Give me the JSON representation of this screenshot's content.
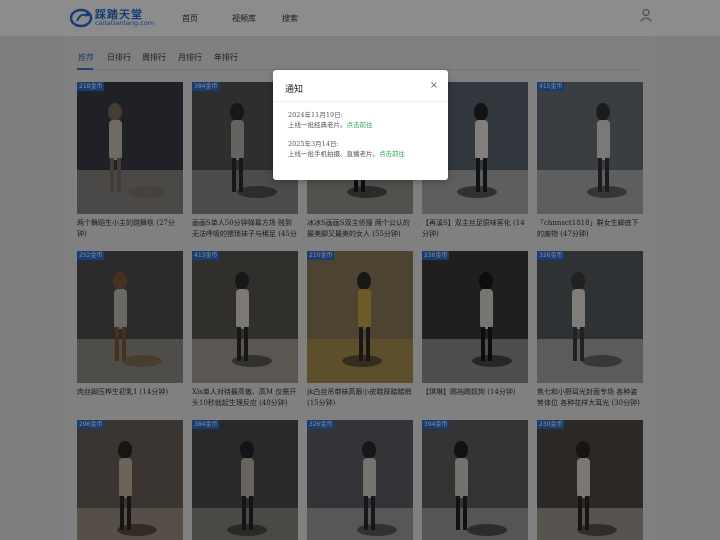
{
  "header": {
    "logo_title": "踩踏天堂",
    "logo_domain": "caitatiantang.com",
    "nav": [
      "首页",
      "视频库",
      "搜索"
    ]
  },
  "tabs": [
    "推荐",
    "日排行",
    "周排行",
    "月排行",
    "年排行"
  ],
  "active_tab": 0,
  "cards": [
    {
      "badge": "218金币",
      "caption": "两个舞蹈生小主的跳舞毯 (27分钟)"
    },
    {
      "badge": "384金币",
      "caption": "画画S单人50分钟弹幕方场 贱到无法呼吸的猥琐袜子与稀足 (45分"
    },
    {
      "badge": "",
      "caption": "冰冰S画画S双主侦搜 两个公认的最美脚又最美的女人 (55分钟)"
    },
    {
      "badge": "",
      "caption": "【再溪S】双主丝足原味客化 (14分钟)"
    },
    {
      "badge": "415金币",
      "caption": "「chnnsct1818」群女生脚底下的废物 (47分钟)"
    },
    {
      "badge": "252金币",
      "caption": "肉丝脚压桦生初乳1 (14分钟)"
    },
    {
      "badge": "413金币",
      "caption": "Xls单人对待最高傲、高M 仅需开头10秒就起生理反应 (48分钟)"
    },
    {
      "badge": "210金币",
      "caption": "jk白丝吊带袜高跟小皮鞋踩踏踏梢 (15分钟)"
    },
    {
      "badge": "230金币",
      "caption": "【琪琳】踢裆踢奴狗 (14分钟)"
    },
    {
      "badge": "326金币",
      "caption": "焦七和小野耳光封面专场 各种姿势体位 各种花样大耳光 (30分钟)"
    },
    {
      "badge": "296金币",
      "caption": ""
    },
    {
      "badge": "384金币",
      "caption": ""
    },
    {
      "badge": "326金币",
      "caption": ""
    },
    {
      "badge": "394金币",
      "caption": ""
    },
    {
      "badge": "230金币",
      "caption": ""
    }
  ],
  "modal": {
    "title": "通知",
    "close": "×",
    "notices": [
      {
        "date": "2024年11月19日:",
        "text": "上线一批经典老片。",
        "link": "点击前往"
      },
      {
        "date": "2025年3月14日:",
        "text": "上线一批手机拍摄、直播老片。",
        "link": "点击前往"
      }
    ]
  },
  "colors": {
    "brand": "#2b6fd6",
    "badge": "#2f6fd0",
    "link": "#2fa84f"
  }
}
